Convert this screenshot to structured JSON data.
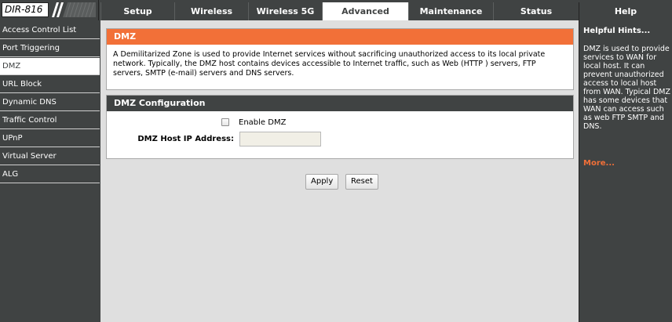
{
  "header": {
    "model": "DIR-816",
    "tabs": [
      {
        "label": "Setup"
      },
      {
        "label": "Wireless"
      },
      {
        "label": "Wireless 5G"
      },
      {
        "label": "Advanced"
      },
      {
        "label": "Maintenance"
      },
      {
        "label": "Status"
      },
      {
        "label": "Help"
      }
    ],
    "active_tab": "Advanced"
  },
  "sidebar": {
    "items": [
      {
        "label": "Access Control List"
      },
      {
        "label": "Port Triggering"
      },
      {
        "label": "DMZ"
      },
      {
        "label": "URL Block"
      },
      {
        "label": "Dynamic DNS"
      },
      {
        "label": "Traffic Control"
      },
      {
        "label": "UPnP"
      },
      {
        "label": "Virtual Server"
      },
      {
        "label": "ALG"
      }
    ],
    "active_item": "DMZ"
  },
  "dmz_panel": {
    "title": "DMZ",
    "description": "A Demilitarized Zone is used to provide Internet services without sacrificing unauthorized access to its local private network. Typically, the DMZ host contains devices accessible to Internet traffic, such as Web (HTTP ) servers, FTP servers, SMTP (e-mail) servers and DNS servers."
  },
  "config_panel": {
    "title": "DMZ Configuration",
    "enable_label": "Enable DMZ",
    "enable_checked": false,
    "ip_label": "DMZ Host IP Address:",
    "ip_value": ""
  },
  "actions": {
    "apply_label": "Apply",
    "reset_label": "Reset"
  },
  "help": {
    "title": "Helpful Hints...",
    "text": "DMZ is used to provide services to WAN for local host. It can prevent unauthorized access to local host from WAN. Typical DMZ has some devices that WAN can access such as web FTP SMTP and DNS.",
    "more_label": "More..."
  },
  "colors": {
    "chrome": "#404343",
    "accent_orange": "#f27038",
    "content_bg": "#dfdfdf",
    "input_bg": "#f1efe6"
  }
}
